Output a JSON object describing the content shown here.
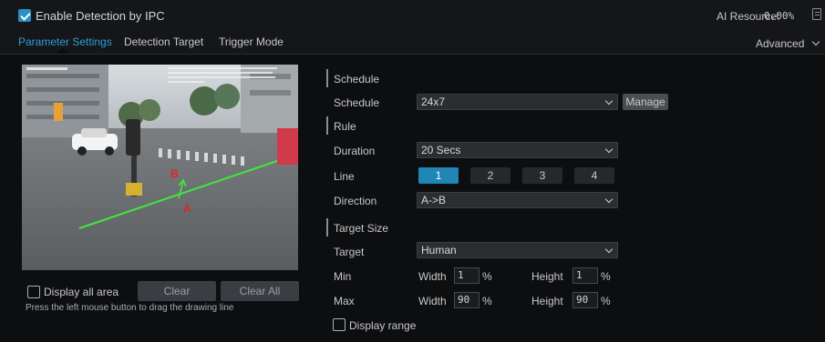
{
  "header": {
    "enable_label": "Enable Detection by IPC",
    "enable_checked": true,
    "ai_resource_label": "AI Resource:",
    "ai_resource_value": "0.00%"
  },
  "tabs": [
    {
      "label": "Parameter Settings",
      "active": true
    },
    {
      "label": "Detection Target",
      "active": false
    },
    {
      "label": "Trigger Mode",
      "active": false
    }
  ],
  "advanced_label": "Advanced",
  "video": {
    "label_a": "A",
    "label_b": "B"
  },
  "left_controls": {
    "display_all_area": "Display all area",
    "clear": "Clear",
    "clear_all": "Clear All",
    "hint": "Press the left mouse button to drag the drawing line"
  },
  "schedule": {
    "section": "Schedule",
    "label": "Schedule",
    "value": "24x7",
    "manage": "Manage"
  },
  "rule": {
    "section": "Rule",
    "duration_label": "Duration",
    "duration_value": "20 Secs",
    "line_label": "Line",
    "lines": [
      "1",
      "2",
      "3",
      "4"
    ],
    "active_line": "1",
    "direction_label": "Direction",
    "direction_value": "A->B"
  },
  "target_size": {
    "section": "Target Size",
    "target_label": "Target",
    "target_value": "Human",
    "min_label": "Min",
    "max_label": "Max",
    "width_label": "Width",
    "height_label": "Height",
    "unit": "%",
    "min_width": "1",
    "min_height": "1",
    "max_width": "90",
    "max_height": "90",
    "display_range": "Display range"
  },
  "colors": {
    "accent": "#2b9fd8",
    "active_line_bg": "#1f86b6",
    "detection_line": "#3ee83e",
    "marker_label": "#e02424"
  }
}
